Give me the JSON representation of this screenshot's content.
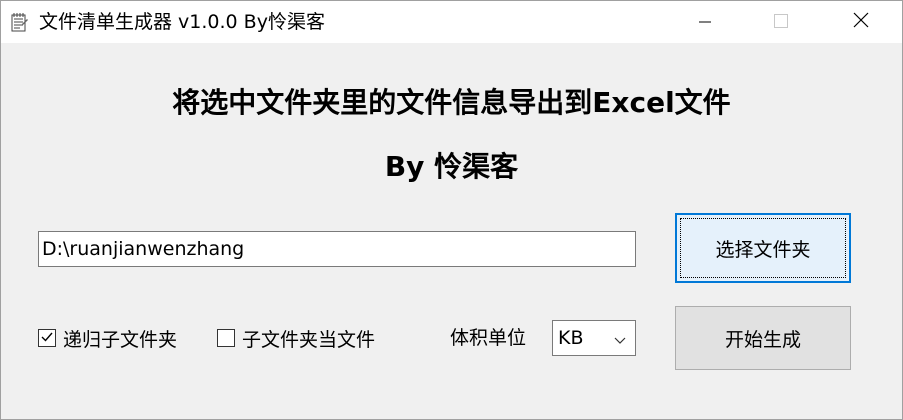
{
  "window": {
    "title": "文件清单生成器 v1.0.0 By怜渠客",
    "icon": "notepad-icon",
    "controls": [
      "minimize-icon",
      "maximize-icon",
      "close-icon"
    ]
  },
  "main": {
    "heading": "将选中文件夹里的文件信息导出到Excel文件",
    "subheading": "By 怜渠客",
    "path_value": "D:\\ruanjianwenzhang",
    "select_folder_label": "选择文件夹",
    "generate_label": "开始生成",
    "recursive_label": "递归子文件夹",
    "recursive_checked": true,
    "sub_as_file_label": "子文件夹当文件",
    "sub_as_file_checked": false,
    "unit_label": "体积单位",
    "unit_value": "KB"
  },
  "colors": {
    "focus_border": "#0078d7",
    "window_bg": "#f0f0f0",
    "button_bg": "#e1e1e1"
  }
}
